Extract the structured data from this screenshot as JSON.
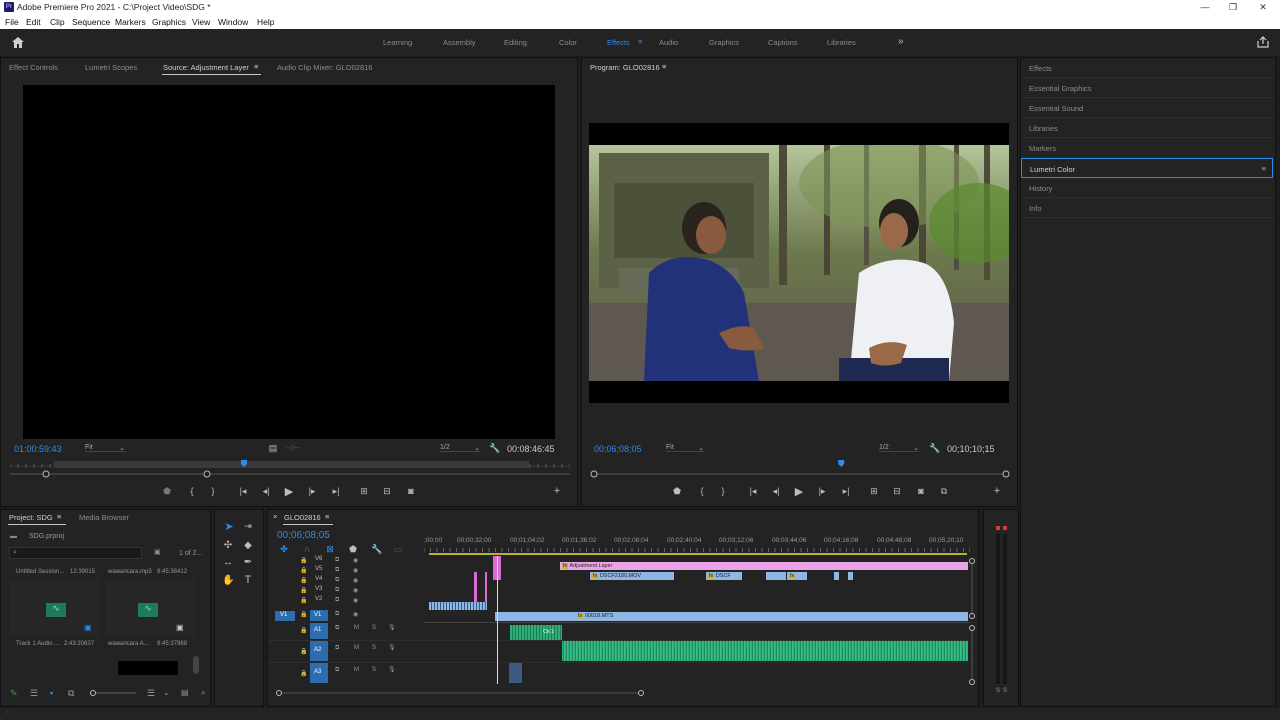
{
  "app": {
    "title": "Adobe Premiere Pro 2021 - C:\\Project Video\\SDG *",
    "logo": "Pr"
  },
  "window_controls": [
    "—",
    "❐",
    "✕"
  ],
  "menu": [
    "File",
    "Edit",
    "Clip",
    "Sequence",
    "Markers",
    "Graphics",
    "View",
    "Window",
    "Help"
  ],
  "workspaces": [
    "Learning",
    "Assembly",
    "Editing",
    "Color",
    "Effects",
    "Audio",
    "Graphics",
    "Captions",
    "Libraries"
  ],
  "active_workspace": "Effects",
  "source_panel": {
    "tabs": [
      "Effect Controls",
      "Lumetri Scopes",
      "Source: Adjustment Layer",
      "Audio Clip Mixer: GLO02816"
    ],
    "timecode": "01:00:59:43",
    "fit": "Fit",
    "resolution": "1/2",
    "duration": "00:08:46:45",
    "playhead_fraction": 0.4
  },
  "program_panel": {
    "title": "Program: GLO02816",
    "timecode": "00;06;08;05",
    "fit": "Fit",
    "resolution": "1/2",
    "duration": "00;10;10;15",
    "playhead_fraction": 0.6
  },
  "right_panel": {
    "items": [
      "Effects",
      "Essential Graphics",
      "Essential Sound",
      "Libraries",
      "Markers",
      "Lumetri Color",
      "History",
      "Info"
    ],
    "active": "Lumetri Color"
  },
  "project_panel": {
    "tabs": [
      "Project: SDG",
      "Media Browser"
    ],
    "file": "SDG.prproj",
    "page": "1 of 2...",
    "items": [
      {
        "name": "Untitled Session...",
        "duration": "12:39015"
      },
      {
        "name": "wawancara.mp3",
        "duration": "8:45:38412"
      },
      {
        "name": "Track 1 Audio ...",
        "duration": "2:43:20637"
      },
      {
        "name": "wawancara A...",
        "duration": "8:45:37968"
      }
    ]
  },
  "timeline": {
    "tab": "GLO02816",
    "timecode": "00;06;08;05",
    "ruler": [
      ";00;00",
      "00;00;32;00",
      "00;01;04;02",
      "00;01;36;02",
      "00;02;08;04",
      "00;02;40;04",
      "00;03;12;06",
      "00;03;44;06",
      "00;04;16;08",
      "00;04;48;08",
      "00;05;20;10"
    ],
    "video_tracks": [
      "V6",
      "V5",
      "V4",
      "V3",
      "V2",
      "V1"
    ],
    "audio_tracks": [
      "A1",
      "A2",
      "A3"
    ],
    "source_patch_v": "V1",
    "clips": {
      "adjustment": "Adjustment Layer",
      "dsc1": "DSCF2180.MOV",
      "dsc2": "DSCF",
      "v1": "00018.MTS",
      "ch1": "Ch 1"
    },
    "fx": "fx",
    "meter_labels": [
      "S",
      "S"
    ]
  },
  "colors": {
    "accent": "#2d8ceb",
    "adjustment_clip": "#e9a3e6",
    "video_clip": "#8fb7e6",
    "audio_clip": "#2fae7a"
  }
}
